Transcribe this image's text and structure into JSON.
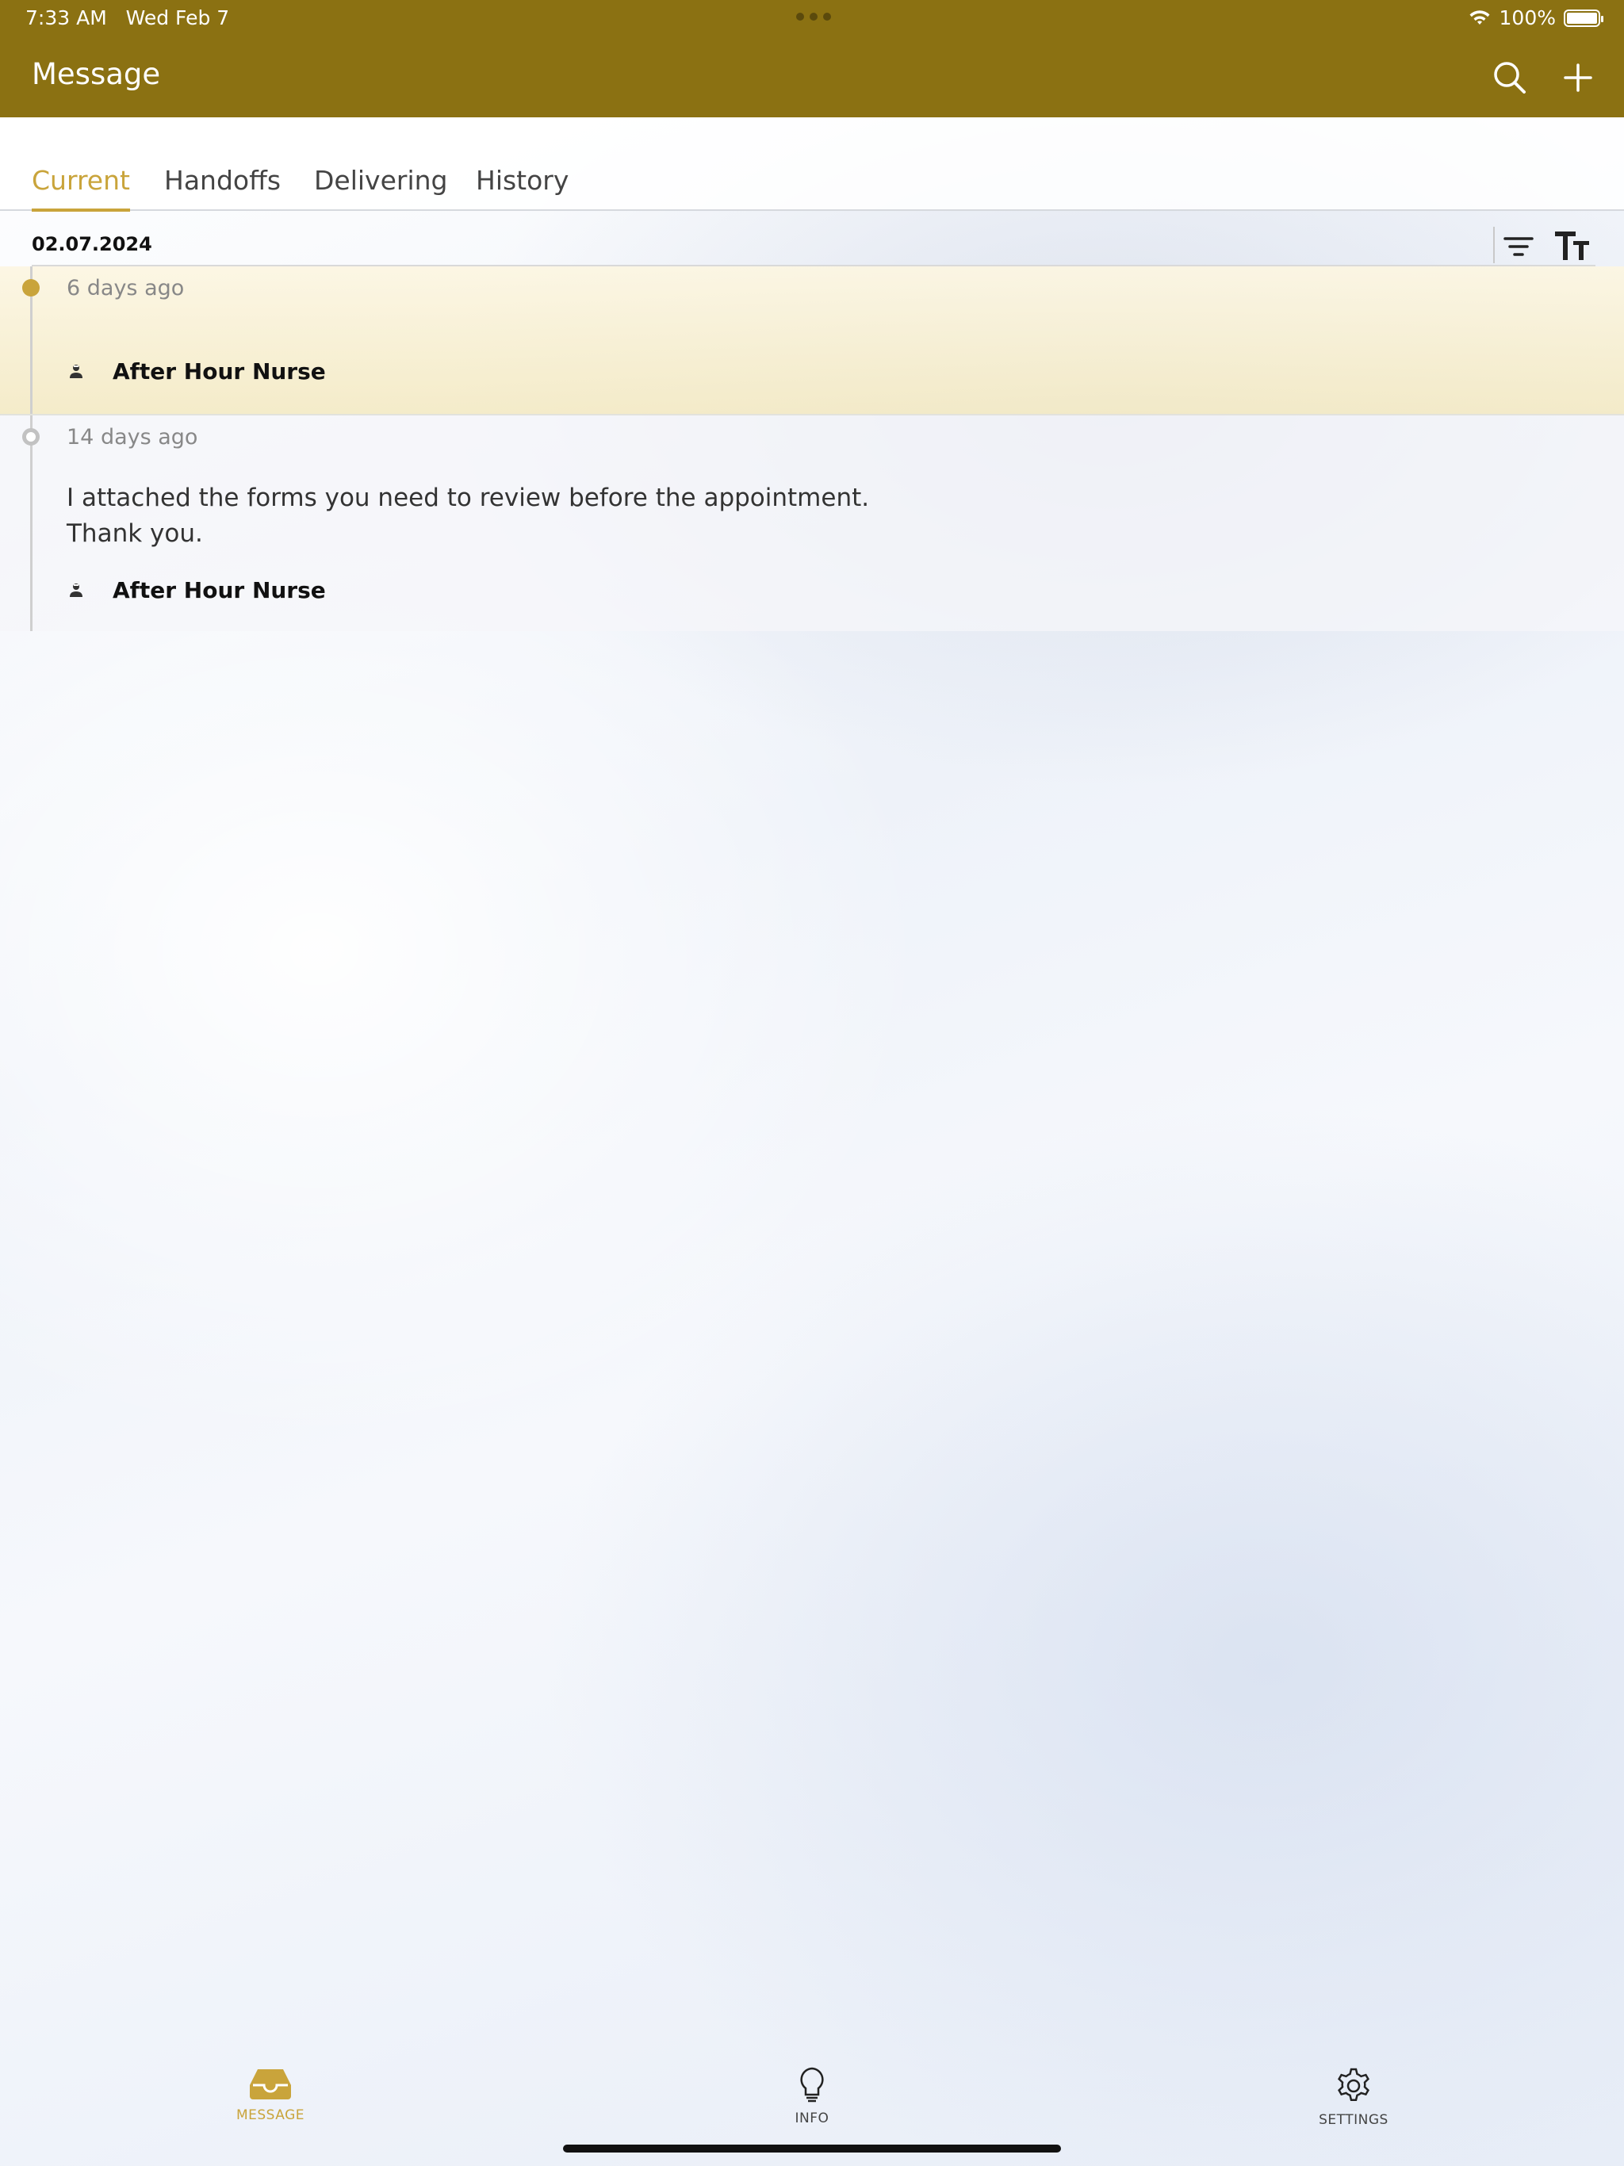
{
  "status_bar": {
    "time": "7:33 AM",
    "date": "Wed Feb 7",
    "battery_percent": "100%",
    "battery_level": 1.0
  },
  "nav": {
    "title": "Message",
    "search_icon": "search-icon",
    "add_icon": "plus-icon"
  },
  "tabs": [
    {
      "label": "Current",
      "active": true
    },
    {
      "label": "Handoffs",
      "active": false
    },
    {
      "label": "Delivering",
      "active": false
    },
    {
      "label": "History",
      "active": false
    }
  ],
  "date_header": "02.07.2024",
  "toolbar": {
    "filter_icon": "filter-icon",
    "text_size_icon": "text-size-icon"
  },
  "messages": [
    {
      "time": "6 days ago",
      "body": "",
      "sender": "After Hour Nurse",
      "unread": true
    },
    {
      "time": "14 days ago",
      "body_lines": [
        "I attached the forms you need to review before the appointment.",
        "Thank you."
      ],
      "sender": "After Hour Nurse",
      "unread": false
    }
  ],
  "tabbar": [
    {
      "label": "MESSAGE",
      "icon": "inbox-icon",
      "active": true
    },
    {
      "label": "INFO",
      "icon": "lightbulb-icon",
      "active": false
    },
    {
      "label": "SETTINGS",
      "icon": "gear-icon",
      "active": false
    }
  ],
  "colors": {
    "brand_bar": "#8b7112",
    "accent": "#c9a43b",
    "unread_highlight": "#f4eac4"
  }
}
